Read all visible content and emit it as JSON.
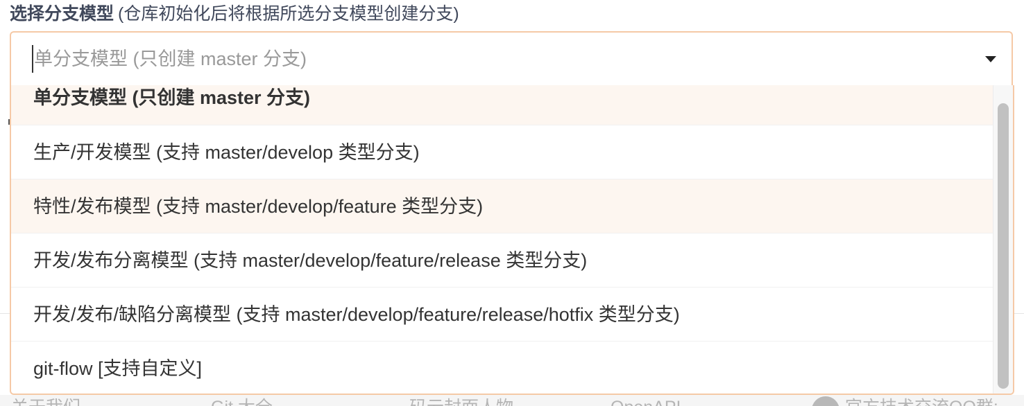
{
  "field": {
    "label": "选择分支模型",
    "hint": "(仓库初始化后将根据所选分支模型创建分支)"
  },
  "select": {
    "placeholder": "单分支模型 (只创建 master 分支)"
  },
  "options": [
    "单分支模型 (只创建 master 分支)",
    "生产/开发模型 (支持 master/develop 类型分支)",
    "特性/发布模型 (支持 master/develop/feature 类型分支)",
    "开发/发布分离模型 (支持 master/develop/feature/release 类型分支)",
    "开发/发布/缺陷分离模型 (支持 master/develop/feature/release/hotfix 类型分支)",
    "git-flow [支持自定义]"
  ],
  "footer": {
    "links": [
      "关于我们",
      "Git 大全",
      "码云封面人物",
      "OpenAPI"
    ],
    "qq_group": "官方技术交流QQ群:"
  },
  "colors": {
    "accent_border": "#f5c9a6",
    "option_highlight": "#fdf6f0"
  },
  "icons": {
    "caret": "caret-down-icon",
    "footer": "user-icon"
  }
}
